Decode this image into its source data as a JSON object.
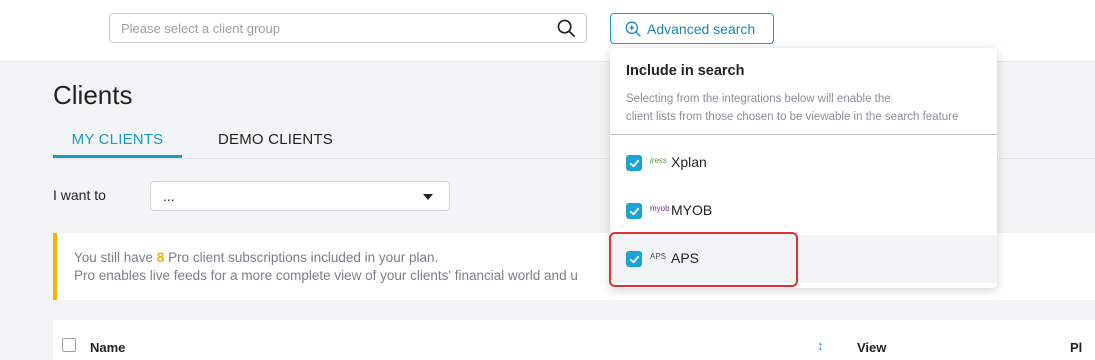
{
  "search": {
    "placeholder": "Please select a client group"
  },
  "advanced_search": {
    "label": "Advanced search"
  },
  "page": {
    "title": "Clients"
  },
  "tabs": [
    {
      "label": "MY CLIENTS",
      "active": true
    },
    {
      "label": "DEMO CLIENTS",
      "active": false
    }
  ],
  "i_want_to": {
    "label": "I want to",
    "value": "..."
  },
  "banner": {
    "line1_pre": "You still have ",
    "line1_count": "8",
    "line1_post": " Pro client subscriptions included in your plan.",
    "line2": "Pro enables live feeds for a more complete view of your clients' financial world and u"
  },
  "table": {
    "columns": [
      "Name",
      "View",
      "Pl"
    ]
  },
  "dropdown": {
    "title": "Include in search",
    "description_line1": "Selecting from the integrations below will enable the",
    "description_line2": "client lists from those chosen to be viewable in the search feature",
    "items": [
      {
        "logo": "iress",
        "label": "Xplan",
        "checked": true
      },
      {
        "logo": "myob",
        "label": "MYOB",
        "checked": true
      },
      {
        "logo": "APS",
        "label": "APS",
        "checked": true
      }
    ]
  },
  "colors": {
    "accent": "#1b9bc9",
    "warning": "#f5b300",
    "highlight": "#e03030"
  }
}
